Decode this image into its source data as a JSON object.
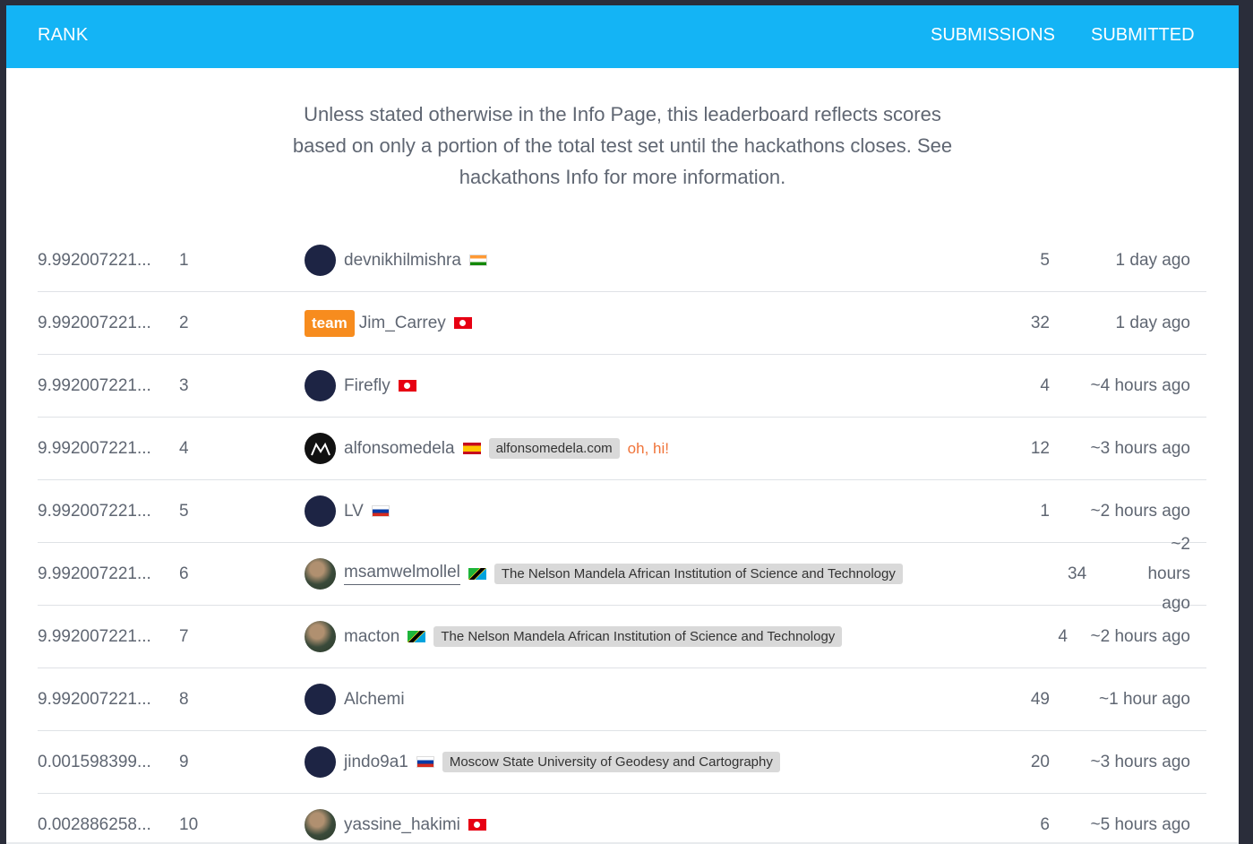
{
  "header": {
    "rank_label": "RANK",
    "submissions_label": "SUBMISSIONS",
    "submitted_label": "SUBMITTED",
    "bg_color": "#14b4f5"
  },
  "notice": "Unless stated otherwise in the Info Page, this leaderboard reflects scores based on only a portion of the total test set until the hackathons closes. See hackathons Info for more information.",
  "rows": [
    {
      "score": "9.992007221...",
      "rank": "1",
      "user": "devnikhilmishra",
      "avatar": "default-avatar",
      "flag": "india-flag",
      "team": "",
      "affiliation": "",
      "note": "",
      "submissions": "5",
      "submitted": "1 day ago"
    },
    {
      "score": "9.992007221...",
      "rank": "2",
      "user": "Jim_Carrey",
      "avatar": "",
      "flag": "tunisia-flag",
      "team": "team",
      "affiliation": "",
      "note": "",
      "submissions": "32",
      "submitted": "1 day ago"
    },
    {
      "score": "9.992007221...",
      "rank": "3",
      "user": "Firefly",
      "avatar": "default-avatar",
      "flag": "tunisia-flag",
      "team": "",
      "affiliation": "",
      "note": "",
      "submissions": "4",
      "submitted": "~4 hours ago"
    },
    {
      "score": "9.992007221...",
      "rank": "4",
      "user": "alfonsomedela",
      "avatar": "logo-avatar",
      "flag": "spain-flag",
      "team": "",
      "affiliation": "alfonsomedela.com",
      "note": "oh, hi!",
      "submissions": "12",
      "submitted": "~3 hours ago"
    },
    {
      "score": "9.992007221...",
      "rank": "5",
      "user": "LV",
      "avatar": "default-avatar",
      "flag": "russia-flag",
      "team": "",
      "affiliation": "",
      "note": "",
      "submissions": "1",
      "submitted": "~2 hours ago"
    },
    {
      "score": "9.992007221...",
      "rank": "6",
      "user": "msamwelmollel",
      "avatar": "photo-avatar",
      "flag": "tanzania-flag",
      "team": "",
      "affiliation": "The Nelson Mandela African Institution of Science and Technology",
      "note": "",
      "submissions": "34",
      "submitted": "~2 hours ago"
    },
    {
      "score": "9.992007221...",
      "rank": "7",
      "user": "macton",
      "avatar": "photo-avatar",
      "flag": "tanzania-flag",
      "team": "",
      "affiliation": "The Nelson Mandela African Institution of Science and Technology",
      "note": "",
      "submissions": "4",
      "submitted": "~2 hours ago"
    },
    {
      "score": "9.992007221...",
      "rank": "8",
      "user": "Alchemi",
      "avatar": "default-avatar",
      "flag": "",
      "team": "",
      "affiliation": "",
      "note": "",
      "submissions": "49",
      "submitted": "~1 hour ago"
    },
    {
      "score": "0.001598399...",
      "rank": "9",
      "user": "jindo9a1",
      "avatar": "default-avatar",
      "flag": "russia-flag",
      "team": "",
      "affiliation": "Moscow State University of Geodesy and Cartography",
      "note": "",
      "submissions": "20",
      "submitted": "~3 hours ago"
    },
    {
      "score": "0.002886258...",
      "rank": "10",
      "user": "yassine_hakimi",
      "avatar": "photo-avatar",
      "flag": "tunisia-flag",
      "team": "",
      "affiliation": "",
      "note": "",
      "submissions": "6",
      "submitted": "~5 hours ago"
    }
  ],
  "row6_time_lines": [
    "~2",
    "hours",
    "ago"
  ]
}
